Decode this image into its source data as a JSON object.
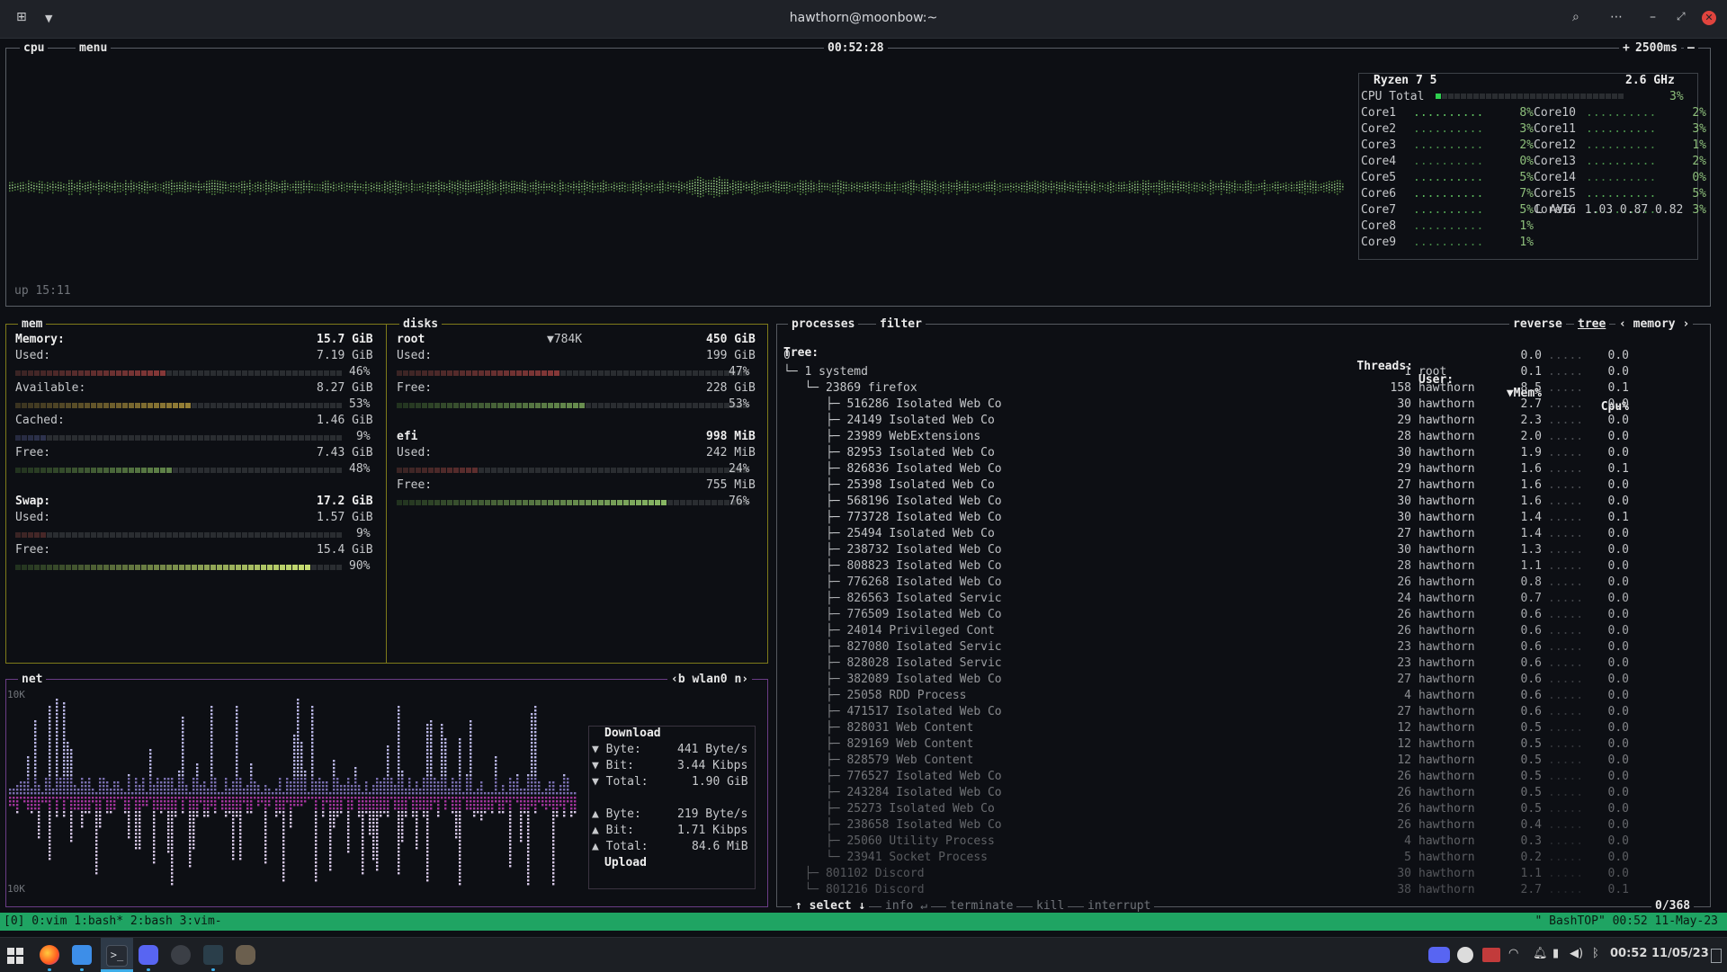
{
  "window": {
    "title": "hawthorn@moonbow:~"
  },
  "cpu_box": {
    "label": "cpu",
    "menu": "menu",
    "clock": "00:52:28",
    "interval": "2500ms",
    "uptime": "up 15:11",
    "cpu_name": "Ryzen 7 5",
    "freq": "2.6 GHz",
    "total_label": "CPU Total",
    "total_pct": "3%",
    "cores_left": [
      {
        "name": "Core1",
        "pct": "8%"
      },
      {
        "name": "Core2",
        "pct": "3%"
      },
      {
        "name": "Core3",
        "pct": "2%"
      },
      {
        "name": "Core4",
        "pct": "0%"
      },
      {
        "name": "Core5",
        "pct": "5%"
      },
      {
        "name": "Core6",
        "pct": "7%"
      },
      {
        "name": "Core7",
        "pct": "5%"
      },
      {
        "name": "Core8",
        "pct": "1%"
      },
      {
        "name": "Core9",
        "pct": "1%"
      }
    ],
    "cores_right": [
      {
        "name": "Core10",
        "pct": "2%"
      },
      {
        "name": "Core11",
        "pct": "3%"
      },
      {
        "name": "Core12",
        "pct": "1%"
      },
      {
        "name": "Core13",
        "pct": "2%"
      },
      {
        "name": "Core14",
        "pct": "0%"
      },
      {
        "name": "Core15",
        "pct": "5%"
      },
      {
        "name": "Core16",
        "pct": "3%"
      }
    ],
    "load_avg": "L AVG: 1.03 0.87 0.82"
  },
  "mem_box": {
    "label": "mem",
    "memory_label": "Memory:",
    "memory_total": "15.7 GiB",
    "used_label": "Used:",
    "used_val": "7.19 GiB",
    "used_pct": "46%",
    "avail_label": "Available:",
    "avail_val": "8.27 GiB",
    "avail_pct": "53%",
    "cached_label": "Cached:",
    "cached_val": "1.46 GiB",
    "cached_pct": "9%",
    "free_label": "Free:",
    "free_val": "7.43 GiB",
    "free_pct": "48%",
    "swap_label": "Swap:",
    "swap_total": "17.2 GiB",
    "swap_used_label": "Used:",
    "swap_used_val": "1.57 GiB",
    "swap_used_pct": "9%",
    "swap_free_label": "Free:",
    "swap_free_val": "15.4 GiB",
    "swap_free_pct": "90%"
  },
  "disks_box": {
    "label": "disks",
    "root_name": "root",
    "root_io": "▼784K",
    "root_total": "450 GiB",
    "root_used_label": "Used:",
    "root_used": "199 GiB",
    "root_used_pct": "47%",
    "root_free_label": "Free:",
    "root_free": "228 GiB",
    "root_free_pct": "53%",
    "efi_name": "efi",
    "efi_total": "998 MiB",
    "efi_used_label": "Used:",
    "efi_used": "242 MiB",
    "efi_used_pct": "24%",
    "efi_free_label": "Free:",
    "efi_free": "755 MiB",
    "efi_free_pct": "76%"
  },
  "net_box": {
    "label": "net",
    "iface": "‹b wlan0 n›",
    "scale_top": "10K",
    "scale_bottom": "10K",
    "download_title": "Download",
    "dl_byte_label": "▼ Byte:",
    "dl_byte": "441 Byte/s",
    "dl_bit_label": "▼ Bit:",
    "dl_bit": "3.44 Kibps",
    "dl_total_label": "▼ Total:",
    "dl_total": "1.90 GiB",
    "ul_byte_label": "▲ Byte:",
    "ul_byte": "219 Byte/s",
    "ul_bit_label": "▲ Bit:",
    "ul_bit": "1.71 Kibps",
    "ul_total_label": "▲ Total:",
    "ul_total": "84.6 MiB",
    "upload_title": "Upload"
  },
  "proc_box": {
    "label": "processes",
    "filter": "filter",
    "reverse": "reverse",
    "tree": "tree",
    "sort": "‹ memory ›",
    "headers": {
      "tree": "Tree:",
      "threads": "Threads:",
      "user": "User:",
      "mem": "▼Mem%",
      "cpu": "Cpu%"
    },
    "rows": [
      {
        "name": "0",
        "thr": "",
        "user": "",
        "mem": "0.0",
        "cpu": "0.0"
      },
      {
        "name": "└─ 1 systemd",
        "thr": "1",
        "user": "root",
        "mem": "0.1",
        "cpu": "0.0"
      },
      {
        "name": "   └─ 23869 firefox",
        "thr": "158",
        "user": "hawthorn",
        "mem": "8.5",
        "cpu": "0.1"
      },
      {
        "name": "      ├─ 516286 Isolated Web Co",
        "thr": "30",
        "user": "hawthorn",
        "mem": "2.7",
        "cpu": "0.0"
      },
      {
        "name": "      ├─ 24149 Isolated Web Co",
        "thr": "29",
        "user": "hawthorn",
        "mem": "2.3",
        "cpu": "0.0"
      },
      {
        "name": "      ├─ 23989 WebExtensions",
        "thr": "28",
        "user": "hawthorn",
        "mem": "2.0",
        "cpu": "0.0"
      },
      {
        "name": "      ├─ 82953 Isolated Web Co",
        "thr": "30",
        "user": "hawthorn",
        "mem": "1.9",
        "cpu": "0.0"
      },
      {
        "name": "      ├─ 826836 Isolated Web Co",
        "thr": "29",
        "user": "hawthorn",
        "mem": "1.6",
        "cpu": "0.1"
      },
      {
        "name": "      ├─ 25398 Isolated Web Co",
        "thr": "27",
        "user": "hawthorn",
        "mem": "1.6",
        "cpu": "0.0"
      },
      {
        "name": "      ├─ 568196 Isolated Web Co",
        "thr": "30",
        "user": "hawthorn",
        "mem": "1.6",
        "cpu": "0.0"
      },
      {
        "name": "      ├─ 773728 Isolated Web Co",
        "thr": "30",
        "user": "hawthorn",
        "mem": "1.4",
        "cpu": "0.1"
      },
      {
        "name": "      ├─ 25494 Isolated Web Co",
        "thr": "27",
        "user": "hawthorn",
        "mem": "1.4",
        "cpu": "0.0"
      },
      {
        "name": "      ├─ 238732 Isolated Web Co",
        "thr": "30",
        "user": "hawthorn",
        "mem": "1.3",
        "cpu": "0.0"
      },
      {
        "name": "      ├─ 808823 Isolated Web Co",
        "thr": "28",
        "user": "hawthorn",
        "mem": "1.1",
        "cpu": "0.0"
      },
      {
        "name": "      ├─ 776268 Isolated Web Co",
        "thr": "26",
        "user": "hawthorn",
        "mem": "0.8",
        "cpu": "0.0"
      },
      {
        "name": "      ├─ 826563 Isolated Servic",
        "thr": "24",
        "user": "hawthorn",
        "mem": "0.7",
        "cpu": "0.0"
      },
      {
        "name": "      ├─ 776509 Isolated Web Co",
        "thr": "26",
        "user": "hawthorn",
        "mem": "0.6",
        "cpu": "0.0"
      },
      {
        "name": "      ├─ 24014 Privileged Cont",
        "thr": "26",
        "user": "hawthorn",
        "mem": "0.6",
        "cpu": "0.0"
      },
      {
        "name": "      ├─ 827080 Isolated Servic",
        "thr": "23",
        "user": "hawthorn",
        "mem": "0.6",
        "cpu": "0.0"
      },
      {
        "name": "      ├─ 828028 Isolated Servic",
        "thr": "23",
        "user": "hawthorn",
        "mem": "0.6",
        "cpu": "0.0"
      },
      {
        "name": "      ├─ 382089 Isolated Web Co",
        "thr": "27",
        "user": "hawthorn",
        "mem": "0.6",
        "cpu": "0.0"
      },
      {
        "name": "      ├─ 25058 RDD Process",
        "thr": "4",
        "user": "hawthorn",
        "mem": "0.6",
        "cpu": "0.0"
      },
      {
        "name": "      ├─ 471517 Isolated Web Co",
        "thr": "27",
        "user": "hawthorn",
        "mem": "0.6",
        "cpu": "0.0"
      },
      {
        "name": "      ├─ 828031 Web Content",
        "thr": "12",
        "user": "hawthorn",
        "mem": "0.5",
        "cpu": "0.0"
      },
      {
        "name": "      ├─ 829169 Web Content",
        "thr": "12",
        "user": "hawthorn",
        "mem": "0.5",
        "cpu": "0.0"
      },
      {
        "name": "      ├─ 828579 Web Content",
        "thr": "12",
        "user": "hawthorn",
        "mem": "0.5",
        "cpu": "0.0"
      },
      {
        "name": "      ├─ 776527 Isolated Web Co",
        "thr": "26",
        "user": "hawthorn",
        "mem": "0.5",
        "cpu": "0.0"
      },
      {
        "name": "      ├─ 243284 Isolated Web Co",
        "thr": "26",
        "user": "hawthorn",
        "mem": "0.5",
        "cpu": "0.0"
      },
      {
        "name": "      ├─ 25273 Isolated Web Co",
        "thr": "26",
        "user": "hawthorn",
        "mem": "0.5",
        "cpu": "0.0"
      },
      {
        "name": "      ├─ 238658 Isolated Web Co",
        "thr": "26",
        "user": "hawthorn",
        "mem": "0.4",
        "cpu": "0.0"
      },
      {
        "name": "      ├─ 25060 Utility Process",
        "thr": "4",
        "user": "hawthorn",
        "mem": "0.3",
        "cpu": "0.0"
      },
      {
        "name": "      └─ 23941 Socket Process",
        "thr": "5",
        "user": "hawthorn",
        "mem": "0.2",
        "cpu": "0.0"
      },
      {
        "name": "   ├─ 801102 Discord",
        "thr": "30",
        "user": "hawthorn",
        "mem": "1.1",
        "cpu": "0.0"
      },
      {
        "name": "   └─ 801216 Discord",
        "thr": "38",
        "user": "hawthorn",
        "mem": "2.7",
        "cpu": "0.1"
      }
    ],
    "footer": {
      "select": "↑ select ↓",
      "info": "info ↵",
      "terminate": "terminate",
      "kill": "kill",
      "interrupt": "interrupt",
      "count": "0/368"
    }
  },
  "tmux": {
    "left": "[0] 0:vim  1:bash* 2:bash  3:vim-",
    "right": "\" BashTOP\" 00:52 11-May-23"
  },
  "taskbar": {
    "apps": [
      "start-menu",
      "firefox",
      "files",
      "terminal",
      "discord",
      "steam",
      "weather",
      "gimp"
    ],
    "time": "00:52",
    "date": "11/05/23"
  },
  "colors": {
    "accent": "#1fa463",
    "mem_border": "#7f7b1a",
    "net_border": "#6a3d86",
    "cpu_graph": "#8ec07c"
  }
}
